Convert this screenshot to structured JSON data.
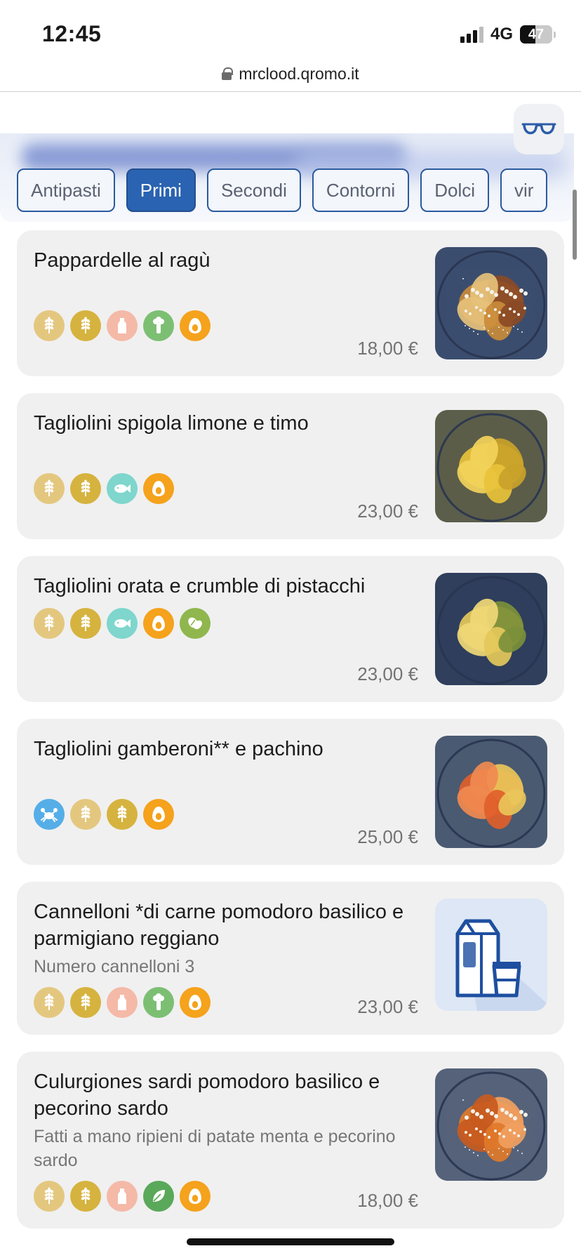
{
  "status_bar": {
    "time": "12:45",
    "network": "4G",
    "battery_level": 47,
    "battery_text": "47"
  },
  "browser": {
    "url": "mrclood.qromo.it"
  },
  "header": {
    "accessibility_icon": "glasses-icon"
  },
  "categories": {
    "active": "Primi",
    "tabs": [
      "Antipasti",
      "Primi",
      "Secondi",
      "Contorni",
      "Dolci",
      "vir"
    ]
  },
  "allergen_styles": {
    "gluten-light": "#e4c77f",
    "gluten-dark": "#d6b33f",
    "milk": "#f5b9a8",
    "celery": "#7cbf73",
    "egg": "#f5a21c",
    "fish": "#7ed6cd",
    "nuts": "#8fb74e",
    "crustaceans": "#55aee8",
    "vegetarian": "#5aa85a"
  },
  "dishes": [
    {
      "name": "Pappardelle al ragù",
      "description": "",
      "price": "18,00 €",
      "allergens": [
        "gluten-light",
        "gluten-dark",
        "milk",
        "celery",
        "egg"
      ],
      "photo": "pappardelle-photo"
    },
    {
      "name": "Tagliolini spigola limone e timo",
      "description": "",
      "price": "23,00 €",
      "allergens": [
        "gluten-light",
        "gluten-dark",
        "fish",
        "egg"
      ],
      "photo": "tagliolini-spigola-photo"
    },
    {
      "name": "Tagliolini orata e crumble di pistacchi",
      "description": "",
      "price": "23,00 €",
      "allergens": [
        "gluten-light",
        "gluten-dark",
        "fish",
        "egg",
        "nuts"
      ],
      "photo": "tagliolini-orata-photo"
    },
    {
      "name": "Tagliolini gamberoni** e pachino",
      "description": "",
      "price": "25,00 €",
      "allergens": [
        "crustaceans",
        "gluten-light",
        "gluten-dark",
        "egg"
      ],
      "photo": "tagliolini-gamberoni-photo"
    },
    {
      "name": "Cannelloni *di carne pomodoro basilico e parmigiano reggiano",
      "description": "Numero cannelloni 3",
      "price": "23,00 €",
      "allergens": [
        "gluten-light",
        "gluten-dark",
        "milk",
        "celery",
        "egg"
      ],
      "photo": "frozen-product-icon"
    },
    {
      "name": "Culurgiones sardi pomodoro basilico e pecorino sardo",
      "description": "Fatti a mano ripieni di patate menta e pecorino sardo",
      "price": "18,00 €",
      "allergens": [
        "gluten-light",
        "gluten-dark",
        "milk",
        "vegetarian",
        "egg"
      ],
      "photo": "culurgiones-photo"
    }
  ]
}
